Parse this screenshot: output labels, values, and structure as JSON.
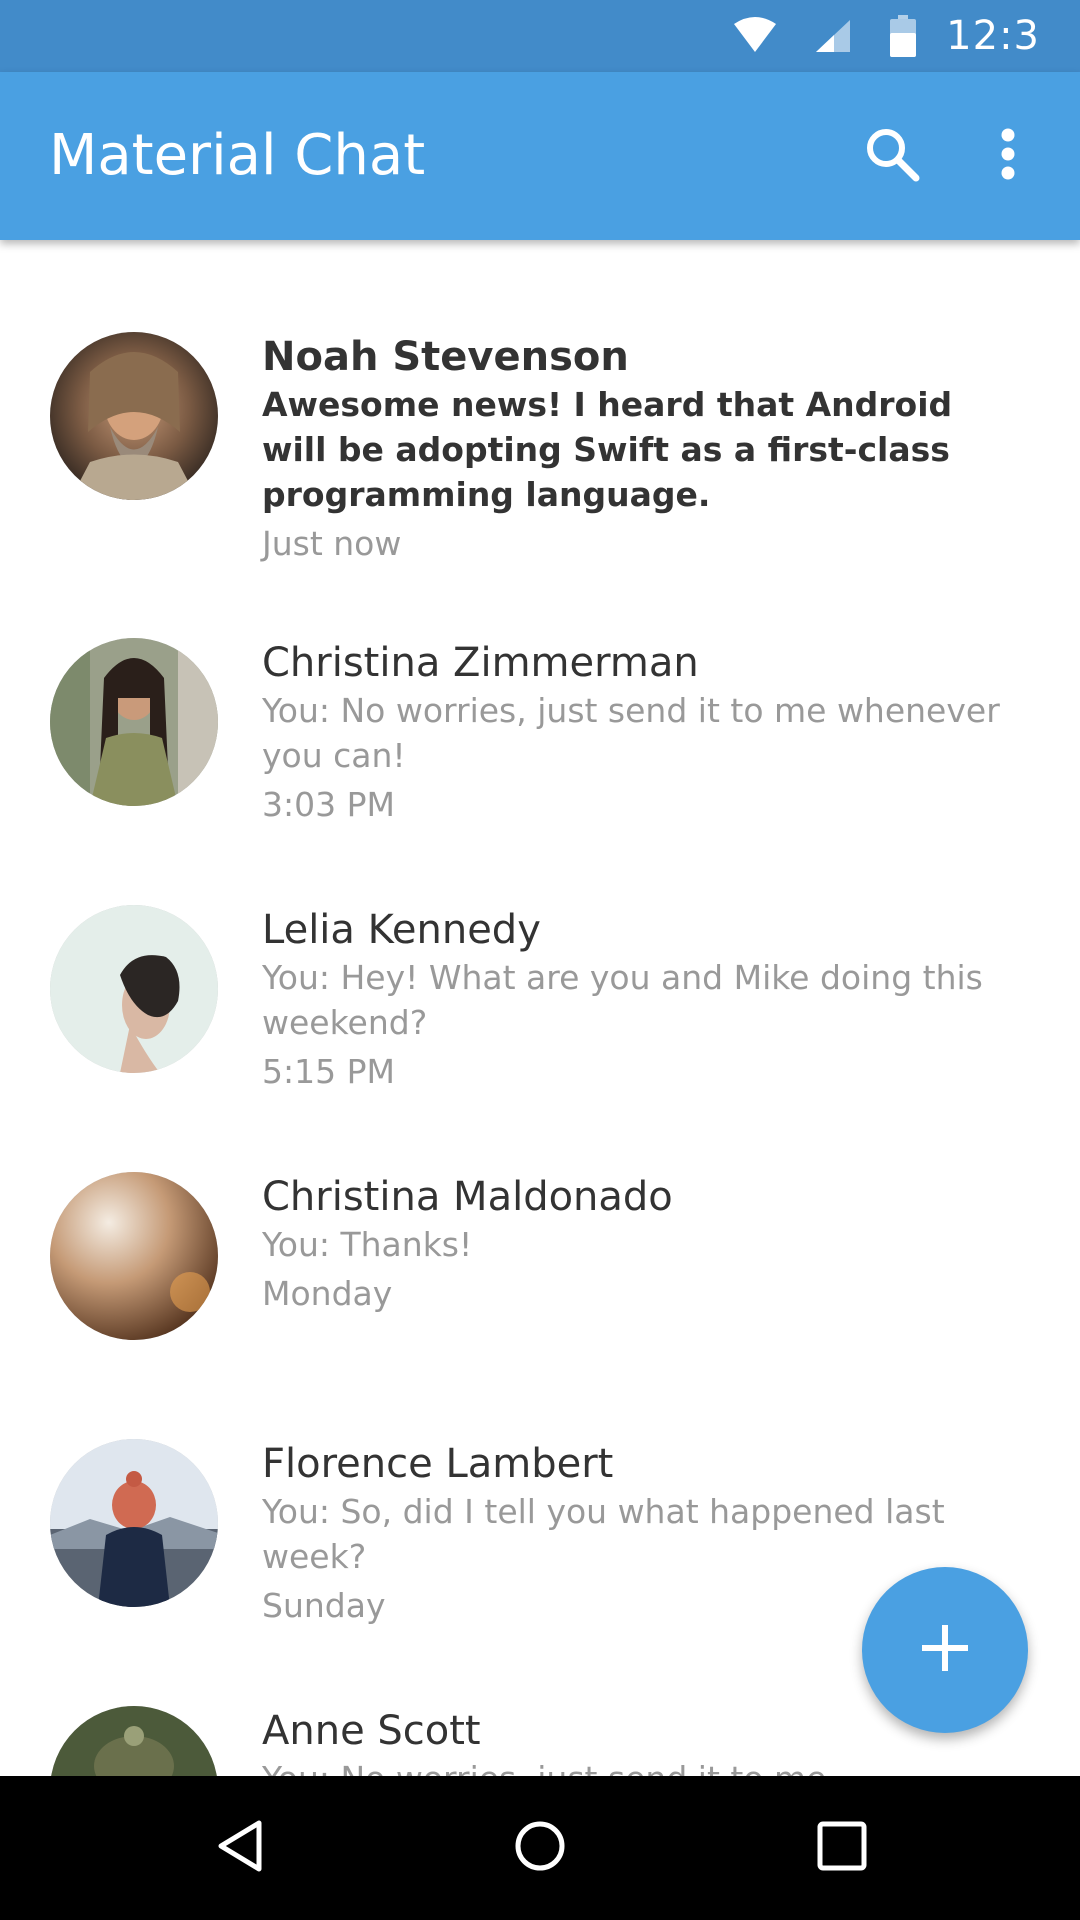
{
  "status_bar": {
    "time": "12:3",
    "icons": [
      "wifi-icon",
      "cell-signal-icon",
      "battery-icon"
    ]
  },
  "app_bar": {
    "title": "Material Chat",
    "actions": [
      "search-icon",
      "more-vert-icon"
    ]
  },
  "conversations": [
    {
      "name": "Noah Stevenson",
      "message": "Awesome news! I heard that Android will be adopting Swift as a first-class programming language.",
      "time": "Just now",
      "unread": true
    },
    {
      "name": "Christina Zimmerman",
      "message": "You: No worries, just send it to me whenever you can!",
      "time": "3:03 PM",
      "unread": false
    },
    {
      "name": "Lelia Kennedy",
      "message": "You: Hey! What are you and Mike doing this weekend?",
      "time": "5:15 PM",
      "unread": false
    },
    {
      "name": "Christina Maldonado",
      "message": "You: Thanks!",
      "time": "Monday",
      "unread": false
    },
    {
      "name": "Florence Lambert",
      "message": "You: So, did I tell you what happened last week?",
      "time": "Sunday",
      "unread": false
    },
    {
      "name": "Anne Scott",
      "message": "You: No worries, just send it to me",
      "time": "",
      "unread": false
    }
  ],
  "fab": {
    "icon": "plus-icon"
  },
  "nav_bar": {
    "buttons": [
      "back-icon",
      "home-icon",
      "recents-icon"
    ]
  },
  "colors": {
    "status_bar": "#428bc9",
    "app_bar": "#4aa0e2",
    "accent": "#4aa0e2",
    "primary_text": "#333333",
    "secondary_text": "#999999"
  }
}
